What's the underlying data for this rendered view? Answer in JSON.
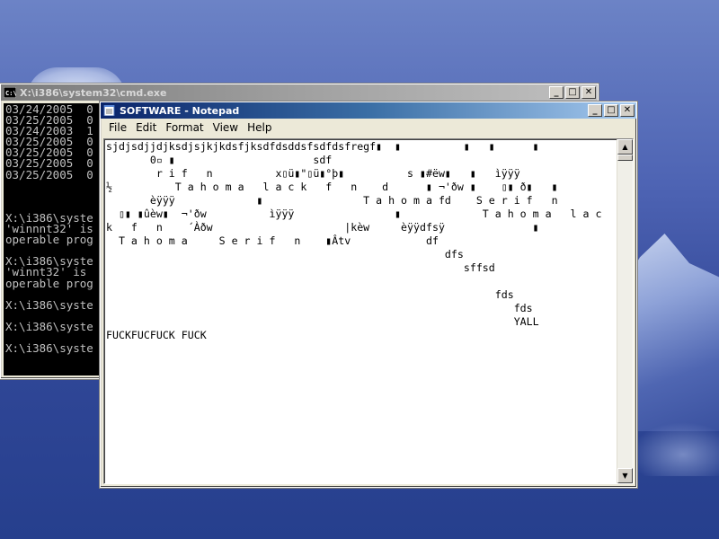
{
  "cmd_window": {
    "title": "X:\\i386\\system32\\cmd.exe",
    "lines": [
      "03/24/2005  0",
      "03/25/2005  0",
      "03/24/2003  1",
      "03/25/2005  0",
      "03/25/2005  0",
      "03/25/2005  0",
      "03/25/2005  0",
      "",
      "",
      "",
      "X:\\i386\\syste",
      "'winnnt32' is",
      "operable prog",
      "",
      "X:\\i386\\syste",
      "'winnt32' is",
      "operable prog",
      "",
      "X:\\i386\\syste",
      "",
      "X:\\i386\\syste",
      "",
      "X:\\i386\\syste"
    ]
  },
  "notepad": {
    "title": "SOFTWARE - Notepad",
    "menu": [
      "File",
      "Edit",
      "Format",
      "View",
      "Help"
    ],
    "lines": [
      "sjdjsdjjdjksdjsjkjkdsfjksdfdsddsfsdfdsfregf▮  ▮          ▮   ▮      ▮",
      "       0▫ ▮                      sdf",
      "        r i f   n          x▯ü▮\"▯ü▮°þ▮          s ▮#ëw▮   ▮   ìÿÿÿ",
      "½          T a h o m a   l a c k   f   n    d      ▮ ¬'ðw ▮    ▯▮ ð▮   ▮",
      "       èÿÿÿ             ▮                T a h o m a fd    S e r i f   n",
      "  ▯▮ ▮ûèw▮  ¬'ðw          ìÿÿÿ                ▮             T a h o m a   l a c",
      "k   f   n    ´Àðw                     |kèw     èÿÿdfsÿ              ▮",
      "  T a h o m a     S e r i f   n    ▮Âtv            df",
      "                                                      dfs",
      "                                                         sffsd",
      "",
      "                                                              fds",
      "                                                                 fds",
      "                                                                 YALL",
      "FUCKFUCFUCK FUCK"
    ]
  }
}
